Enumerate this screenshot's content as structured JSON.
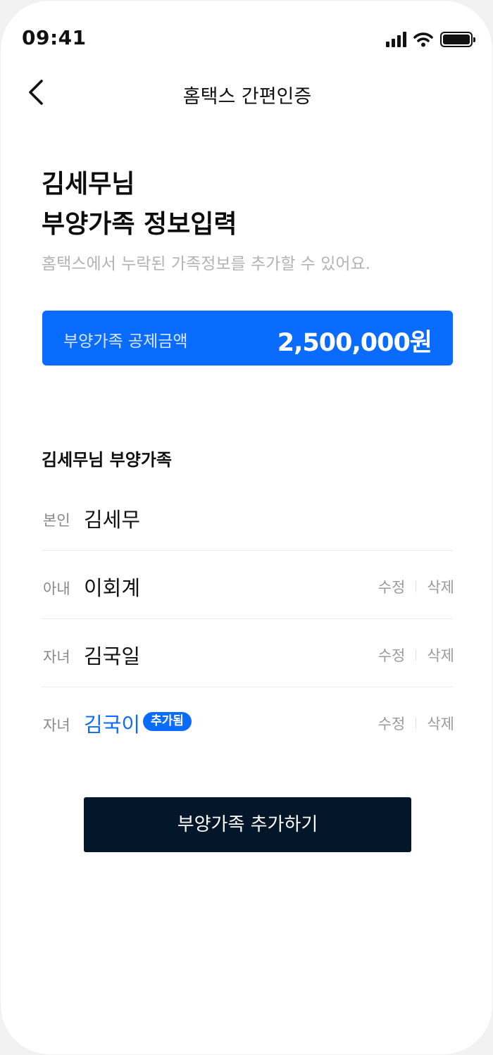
{
  "status_bar": {
    "time": "09:41"
  },
  "nav": {
    "title": "홈택스 간편인증"
  },
  "heading": {
    "line1": "김세무님",
    "line2": "부양가족 정보입력"
  },
  "subtext": "홈택스에서 누락된 가족정보를 추가할 수 있어요.",
  "deduction": {
    "label": "부양가족 공제금액",
    "amount": "2,500,000원"
  },
  "section_title": "김세무님 부양가족",
  "family": [
    {
      "relation": "본인",
      "name": "김세무"
    },
    {
      "relation": "아내",
      "name": "이회계",
      "edit": "수정",
      "delete": "삭제"
    },
    {
      "relation": "자녀",
      "name": "김국일",
      "edit": "수정",
      "delete": "삭제"
    },
    {
      "relation": "자녀",
      "name": "김국이",
      "badge": "추가됨",
      "edit": "수정",
      "delete": "삭제"
    }
  ],
  "add_button": "부양가족 추가하기",
  "colors": {
    "accent": "#0a6cff",
    "button_dark": "#04172a",
    "muted": "#b3b3b3"
  }
}
